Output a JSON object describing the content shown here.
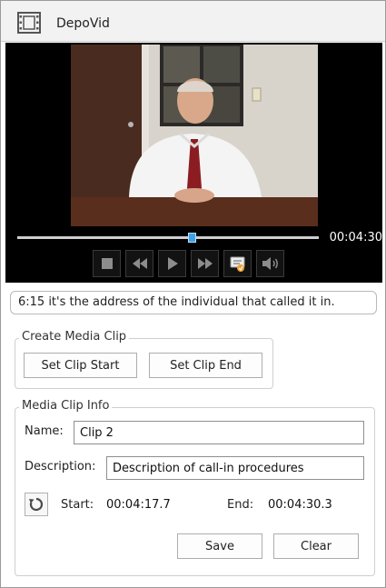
{
  "app": {
    "title": "DepoVid",
    "icon": "film-icon"
  },
  "player": {
    "current_time": "00:04:30",
    "seek_position": 0.58,
    "controls": [
      {
        "name": "stop-icon"
      },
      {
        "name": "rewind-icon"
      },
      {
        "name": "play-icon"
      },
      {
        "name": "fast-forward-icon"
      },
      {
        "name": "caption-icon"
      },
      {
        "name": "volume-icon"
      }
    ]
  },
  "transcript": {
    "line": "6:15 it's the address of the individual that called it in."
  },
  "create_clip": {
    "legend": "Create Media Clip",
    "set_start_label": "Set Clip Start",
    "set_end_label": "Set Clip End"
  },
  "clip_info": {
    "legend": "Media Clip Info",
    "name_label": "Name:",
    "name_value": "Clip 2",
    "description_label": "Description:",
    "description_value": "Description of call-in procedures",
    "start_label": "Start:",
    "start_value": "00:04:17.7",
    "end_label": "End:",
    "end_value": "00:04:30.3",
    "save_label": "Save",
    "clear_label": "Clear"
  },
  "colors": {
    "accent": "#3fa1e6",
    "player_bg": "#000000"
  }
}
